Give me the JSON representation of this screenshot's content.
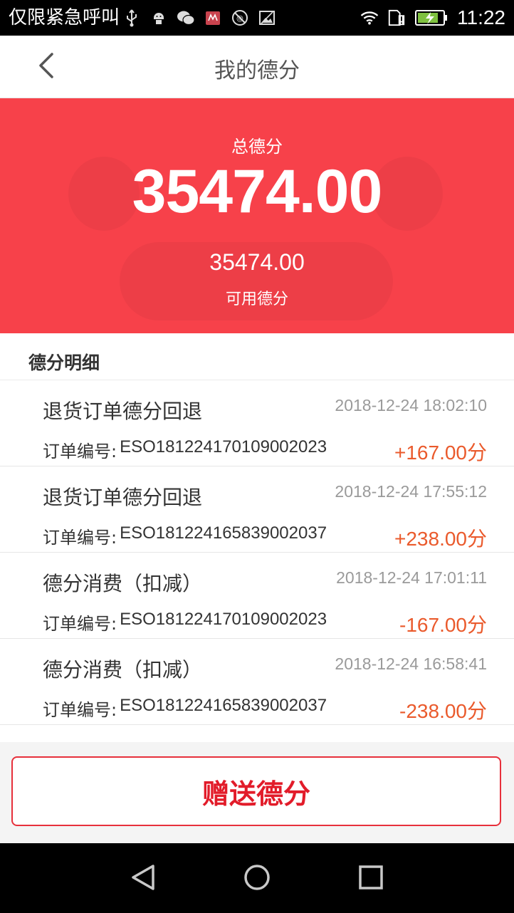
{
  "status_bar": {
    "carrier": "仅限紧急呼叫",
    "icons": [
      "usb-icon",
      "android-icon",
      "wechat-icon",
      "app-icon",
      "no-sim-icon",
      "image-icon"
    ],
    "right_icons": [
      "wifi-icon",
      "sim-warning-icon",
      "battery-charging-icon"
    ],
    "time": "11:22"
  },
  "nav": {
    "back_icon": "chevron-left-icon",
    "title": "我的德分"
  },
  "summary": {
    "total_label": "总德分",
    "total_value": "35474.00",
    "available_value": "35474.00",
    "available_label": "可用德分",
    "bg_color": "#f7414a"
  },
  "detail": {
    "heading": "德分明细",
    "order_prefix": "订单编号:",
    "records": [
      {
        "title": "退货订单德分回退",
        "time": "2018-12-24 18:02:10",
        "order_no": "ESO181224170109002023",
        "amount": "+167.00分"
      },
      {
        "title": "退货订单德分回退",
        "time": "2018-12-24 17:55:12",
        "order_no": "ESO181224165839002037",
        "amount": "+238.00分"
      },
      {
        "title": "德分消费（扣减）",
        "time": "2018-12-24 17:01:11",
        "order_no": "ESO181224170109002023",
        "amount": "-167.00分"
      },
      {
        "title": "德分消费（扣减）",
        "time": "2018-12-24 16:58:41",
        "order_no": "ESO181224165839002037",
        "amount": "-238.00分"
      }
    ],
    "amount_color": "#ea5a2c"
  },
  "actions": {
    "gift_button": "赠送德分",
    "accent": "#e21c2a"
  },
  "system_nav": [
    "back-triangle-icon",
    "home-circle-icon",
    "recents-square-icon"
  ]
}
